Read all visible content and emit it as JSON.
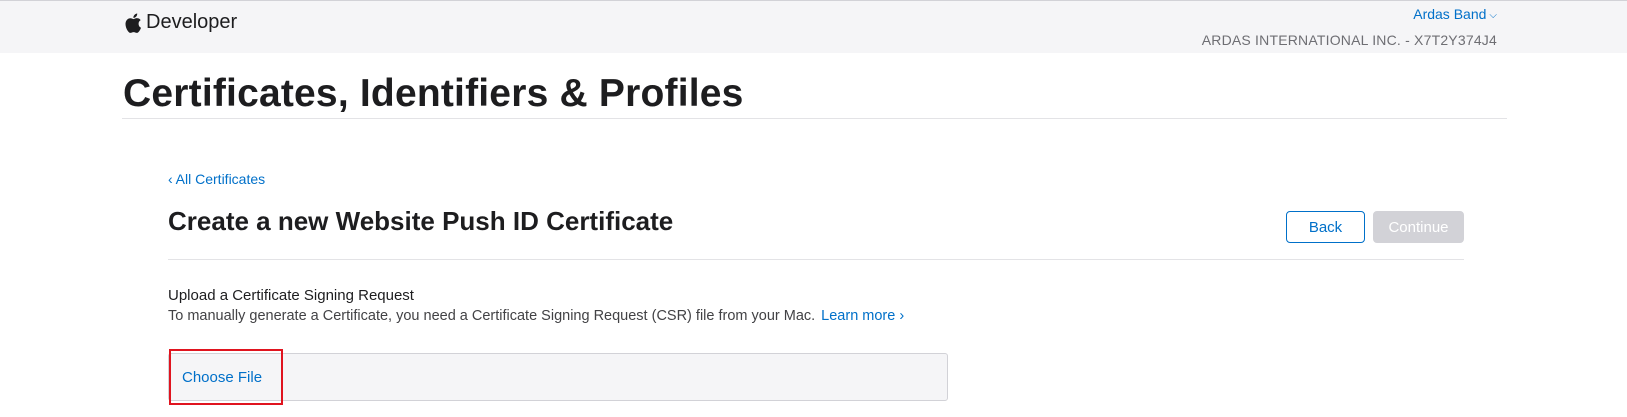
{
  "header": {
    "brand_label": "Developer",
    "brand_icon": "apple-logo-icon",
    "user_name": "Ardas Band",
    "user_chevron": "⌵",
    "org_label": "ARDAS INTERNATIONAL INC. - X7T2Y374J4"
  },
  "page": {
    "title": "Certificates, Identifiers & Profiles"
  },
  "section": {
    "back_link_chevron": "‹",
    "back_link_label": "All Certificates",
    "title": "Create a new Website Push ID Certificate",
    "back_button": "Back",
    "continue_button": "Continue"
  },
  "upload": {
    "heading": "Upload a Certificate Signing Request",
    "description": "To manually generate a Certificate, you need a Certificate Signing Request (CSR) file from your Mac.",
    "learn_more": "Learn more ›",
    "choose_file": "Choose File"
  },
  "colors": {
    "accent": "#0070c9",
    "highlight": "#e0141f",
    "disabled": "#d2d2d7",
    "header_bg": "#f5f5f7"
  }
}
